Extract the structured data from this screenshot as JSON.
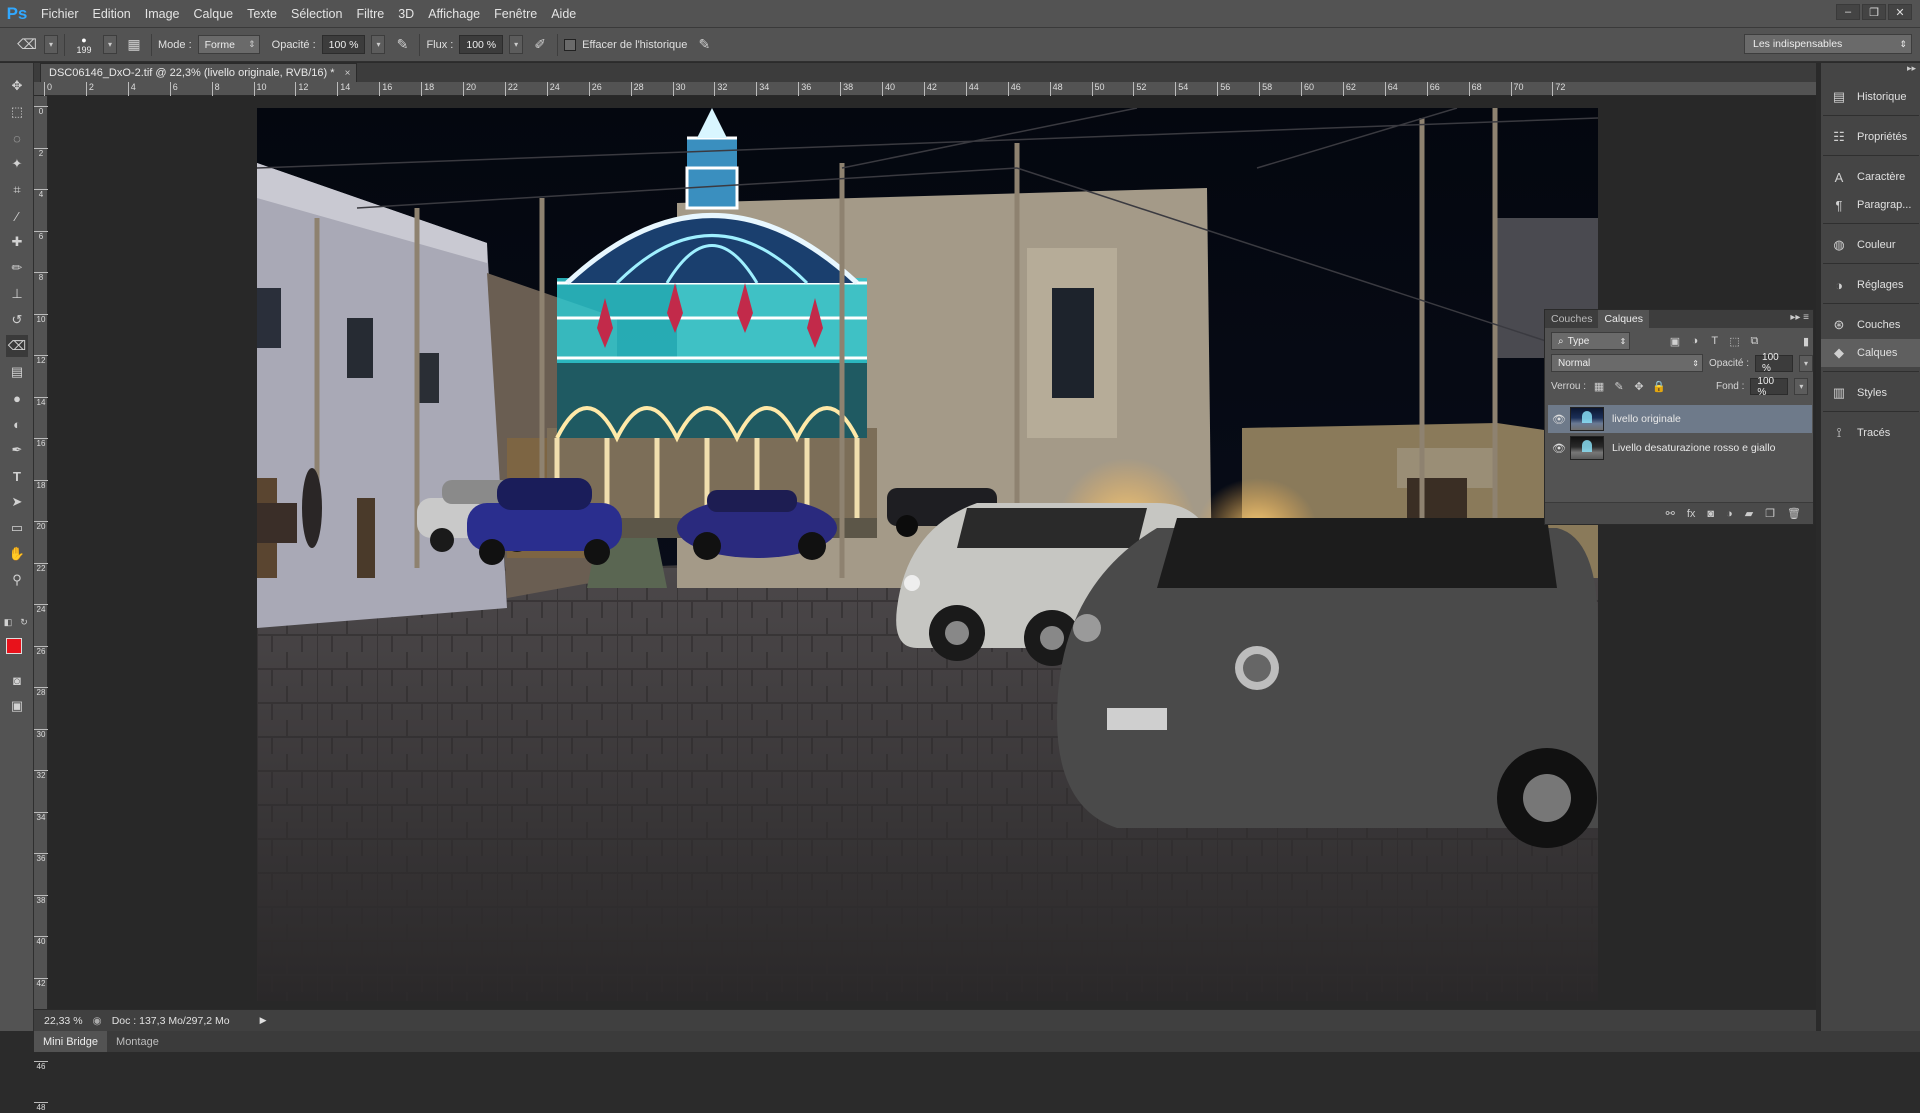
{
  "app": {
    "logo": "Ps"
  },
  "menu": [
    "Fichier",
    "Edition",
    "Image",
    "Calque",
    "Texte",
    "Sélection",
    "Filtre",
    "3D",
    "Affichage",
    "Fenêtre",
    "Aide"
  ],
  "window_controls": {
    "minimize": "–",
    "restore": "❐",
    "close": "✕"
  },
  "options": {
    "brush_size": "199",
    "mode_label": "Mode :",
    "mode_value": "Forme",
    "opacity_label": "Opacité :",
    "opacity_value": "100 %",
    "flow_label": "Flux :",
    "flow_value": "100 %",
    "erase_history_label": "Effacer de l'historique"
  },
  "workspace": "Les indispensables",
  "document": {
    "tab_title": "DSC06146_DxO-2.tif @ 22,3% (livello originale, RVB/16) *",
    "close": "×"
  },
  "ruler": {
    "h": [
      "0",
      "2",
      "4",
      "6",
      "8",
      "10",
      "12",
      "14",
      "16",
      "18",
      "20",
      "22",
      "24",
      "26",
      "28",
      "30",
      "32",
      "34",
      "36",
      "38",
      "40",
      "42",
      "44",
      "46",
      "48",
      "50",
      "52",
      "54",
      "56",
      "58",
      "60",
      "62",
      "64",
      "66",
      "68",
      "70",
      "72"
    ],
    "v": [
      "0",
      "2",
      "4",
      "6",
      "8",
      "10",
      "12",
      "14",
      "16",
      "18",
      "20",
      "22",
      "24",
      "26",
      "28",
      "30",
      "32",
      "34",
      "36",
      "38",
      "40",
      "42",
      "44",
      "46",
      "48"
    ]
  },
  "status": {
    "zoom": "22,33 %",
    "doc_info": "Doc : 137,3 Mo/297,2 Mo"
  },
  "bottom_tabs": [
    "Mini Bridge",
    "Montage"
  ],
  "dock": [
    {
      "label": "Historique",
      "icon": "history-icon"
    },
    {
      "label": "Propriétés",
      "icon": "properties-icon"
    },
    {
      "label": "Caractère",
      "icon": "character-icon"
    },
    {
      "label": "Paragrap...",
      "icon": "paragraph-icon"
    },
    {
      "label": "Couleur",
      "icon": "color-icon"
    },
    {
      "label": "Réglages",
      "icon": "adjustments-icon"
    },
    {
      "label": "Couches",
      "icon": "channels-icon"
    },
    {
      "label": "Calques",
      "icon": "layers-icon"
    },
    {
      "label": "Styles",
      "icon": "styles-icon"
    },
    {
      "label": "Tracés",
      "icon": "paths-icon"
    }
  ],
  "layers_panel": {
    "tabs": [
      "Couches",
      "Calques"
    ],
    "active_tab": "Calques",
    "filter_kind": "Type",
    "blend_mode": "Normal",
    "opacity_label": "Opacité :",
    "opacity_value": "100 %",
    "lock_label": "Verrou :",
    "fill_label": "Fond :",
    "fill_value": "100 %",
    "layers": [
      {
        "name": "livello originale",
        "selected": true
      },
      {
        "name": "Livello desaturazione rosso e giallo",
        "selected": false
      }
    ]
  }
}
